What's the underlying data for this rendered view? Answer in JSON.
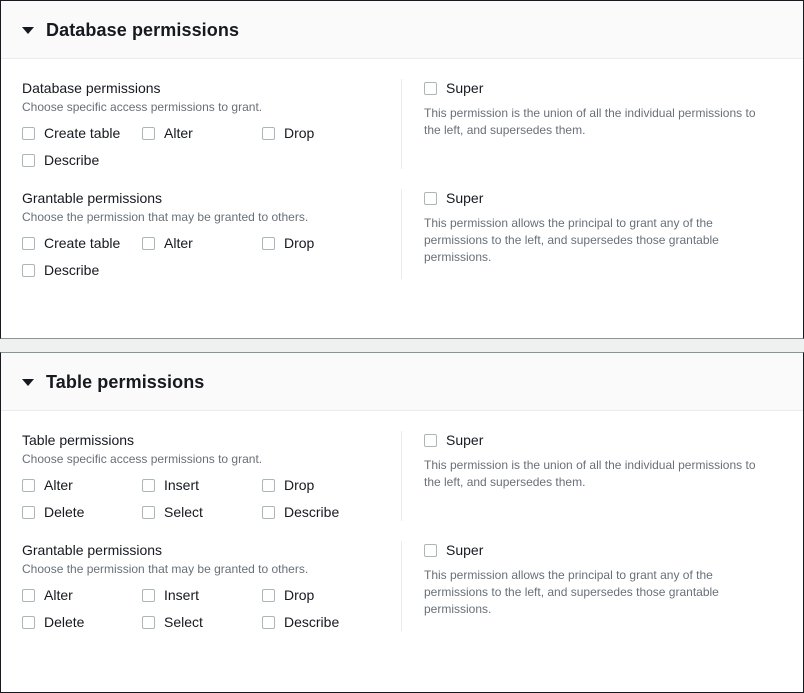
{
  "sections": [
    {
      "id": "database-permissions",
      "header_title": "Database permissions",
      "caret_icon": "caret-down-icon",
      "groups": [
        {
          "id": "database-permissions-group",
          "label": "Database permissions",
          "description": "Choose specific access permissions to grant.",
          "checkboxes": [
            {
              "label": "Create table",
              "checked": false
            },
            {
              "label": "Alter",
              "checked": false
            },
            {
              "label": "Drop",
              "checked": false
            },
            {
              "label": "Describe",
              "checked": false
            }
          ],
          "super": {
            "label": "Super",
            "checked": false,
            "description": "This permission is the union of all the individual permissions to the left, and supersedes them."
          }
        },
        {
          "id": "database-grantable-permissions-group",
          "label": "Grantable permissions",
          "description": "Choose the permission that may be granted to others.",
          "checkboxes": [
            {
              "label": "Create table",
              "checked": false
            },
            {
              "label": "Alter",
              "checked": false
            },
            {
              "label": "Drop",
              "checked": false
            },
            {
              "label": "Describe",
              "checked": false
            }
          ],
          "super": {
            "label": "Super",
            "checked": false,
            "description": "This permission allows the principal to grant any of the permissions to the left, and supersedes those grantable permissions."
          }
        }
      ]
    },
    {
      "id": "table-permissions",
      "header_title": "Table permissions",
      "caret_icon": "caret-down-icon",
      "groups": [
        {
          "id": "table-permissions-group",
          "label": "Table permissions",
          "description": "Choose specific access permissions to grant.",
          "checkboxes": [
            {
              "label": "Alter",
              "checked": false
            },
            {
              "label": "Insert",
              "checked": false
            },
            {
              "label": "Drop",
              "checked": false
            },
            {
              "label": "Delete",
              "checked": false
            },
            {
              "label": "Select",
              "checked": false
            },
            {
              "label": "Describe",
              "checked": false
            }
          ],
          "super": {
            "label": "Super",
            "checked": false,
            "description": "This permission is the union of all the individual permissions to the left, and supersedes them."
          }
        },
        {
          "id": "table-grantable-permissions-group",
          "label": "Grantable permissions",
          "description": "Choose the permission that may be granted to others.",
          "checkboxes": [
            {
              "label": "Alter",
              "checked": false
            },
            {
              "label": "Insert",
              "checked": false
            },
            {
              "label": "Drop",
              "checked": false
            },
            {
              "label": "Delete",
              "checked": false
            },
            {
              "label": "Select",
              "checked": false
            },
            {
              "label": "Describe",
              "checked": false
            }
          ],
          "super": {
            "label": "Super",
            "checked": false,
            "description": "This permission allows the principal to grant any of the permissions to the left, and supersedes those grantable permissions."
          }
        }
      ]
    }
  ],
  "colors": {
    "text_primary": "#16191f",
    "text_secondary": "#687078",
    "panel_background": "#ffffff",
    "header_background": "#fafafa",
    "page_background": "#eff0f0",
    "checkbox_border": "#aab7b8",
    "divider": "#e9ebed"
  }
}
